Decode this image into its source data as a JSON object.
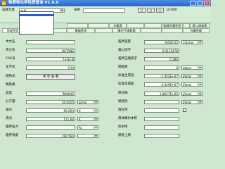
{
  "window": {
    "title": "物质物化学性质查询 V1.0.0",
    "btn_min": "_",
    "btn_max": "□",
    "btn_close": "x"
  },
  "toolbar": {
    "category_label": "选择元素",
    "category_value": "全部",
    "search_label": "名称",
    "search_value": "",
    "btn1": "□",
    "btn2": "□",
    "btn3": "□",
    "page_indicator": "1/1000",
    "dropdown_items": [
      "",
      "",
      "",
      "",
      "",
      "",
      "",
      "",
      "",
      "",
      ""
    ],
    "dropdown_selected": 1
  },
  "tabs_row1": [
    "",
    "",
    "元素周",
    "",
    "",
    "物理元素性质",
    "",
    "第二调查表"
  ],
  "tabs_row2": [
    "常规性质",
    "",
    "基础性质",
    "",
    "摩尔气体数据",
    "",
    "",
    "元素性能"
  ],
  "left": {
    "rows": [
      {
        "label": "中文名",
        "value": "",
        "unit": ""
      },
      {
        "label": "英文名",
        "value": "BUTANE",
        "unit": ""
      },
      {
        "label": "CAS号",
        "value": "74-82-8",
        "unit": ""
      },
      {
        "label": "化学式",
        "value": "CH4",
        "unit": ""
      },
      {
        "label": "结构式",
        "value": "",
        "unit": ""
      },
      {
        "label": "物质类",
        "value": "",
        "unit": ""
      },
      {
        "label": "晶型",
        "value": "直链烷烃",
        "unit": ""
      },
      {
        "label": "分子量",
        "value": "16.0425",
        "unit": "g/mol"
      },
      {
        "label": "熔点",
        "value": "90.694",
        "unit": "K"
      },
      {
        "label": "沸点",
        "value": "111.66",
        "unit": "K"
      },
      {
        "label": "临界压力",
        "value": "",
        "unit": "Pa"
      },
      {
        "label": "临界温度",
        "value": "190.564",
        "unit": ""
      }
    ],
    "structure_button": "共 享 查 看"
  },
  "right": {
    "rows": [
      {
        "label": "临界密度",
        "value": "9.60E-05",
        "unit": "m3/mol"
      },
      {
        "label": "偏心因子",
        "value": "0.0115478",
        "unit": ""
      },
      {
        "label": "临界压缩因子",
        "value": "0.286",
        "unit": ""
      },
      {
        "label": "偶极矩",
        "value": "0",
        "unit": "debye"
      },
      {
        "label": "标准生成焓",
        "value": "-7.452E+07",
        "unit": "J/kmol"
      },
      {
        "label": "标准生成能",
        "value": "-5.049E+07",
        "unit": "J/kmol"
      },
      {
        "label": "绝对熵",
        "value": "1.8627E+05",
        "unit": "J/kmol"
      },
      {
        "label": "燃烧热",
        "value": "",
        "unit": "J/kmol"
      },
      {
        "label": "熔化热",
        "value": "",
        "unit": ""
      },
      {
        "label": "液体摩尔体积",
        "value": "",
        "unit": ""
      },
      {
        "label": "折射率",
        "value": "",
        "unit": ""
      },
      {
        "label": "燃烧上限",
        "value": "",
        "unit": ""
      }
    ]
  },
  "colors": {
    "background": "#cfe6cf",
    "titlebar": "#2862c8",
    "selection": "#2a5fc8"
  }
}
